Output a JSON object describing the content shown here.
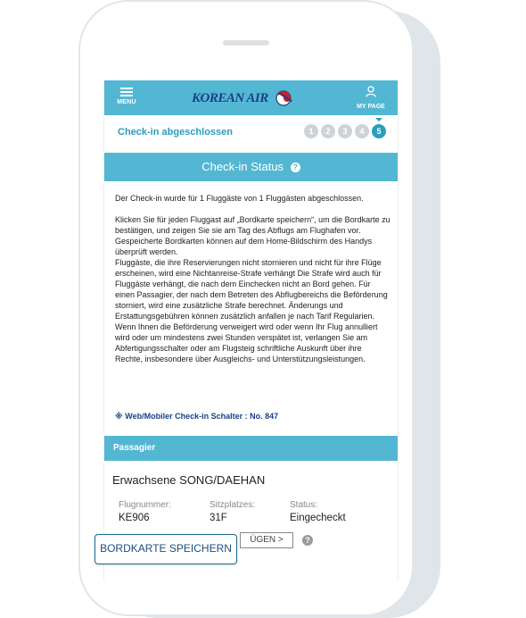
{
  "header": {
    "menu_label": "MENU",
    "brand": "KOREAN AIR",
    "mypage_label": "MY PAGE"
  },
  "steps": {
    "title": "Check-in abgeschlossen",
    "items": [
      "1",
      "2",
      "3",
      "4",
      "5"
    ],
    "active": "5"
  },
  "status": {
    "title": "Check-in Status",
    "help": "?",
    "paragraph_1": "Der Check-in wurde für 1 Fluggäste von 1 Fluggästen abgeschlossen.",
    "paragraph_2": "Klicken Sie für jeden Fluggast auf „Bordkarte speichern“, um die Bordkarte zu bestätigen, und zeigen Sie sie am Tag des Abflugs am Flughafen vor. Gespeicherte Bordkarten können auf dem Home-Bildschirm des Handys überprüft werden.",
    "paragraph_3": "Fluggäste, die ihre Reservierungen nicht stornieren und nicht für ihre Flüge erscheinen, wird eine Nichtanreise-Strafe verhängt Die Strafe wird auch für Fluggäste verhängt, die nach dem Einchecken nicht an Bord gehen. Für einen Passagier, der nach dem Betreten des Abflugbereichs die Beförderung storniert, wird eine zusätzliche Strafe berechnet. Änderungs und Erstattungsgebühren können zusätzlich anfallen je nach Tarif Regularien.",
    "paragraph_4": "Wenn Ihnen die Beförderung verweigert wird oder wenn Ihr Flug annulliert wird oder um mindestens zwei Stunden verspätet ist, verlangen Sie am Abfertigungsschalter oder am Flugsteig schriftliche Auskunft über ihre Rechte, insbesondere über Ausgleichs- und Unterstützungsleistungen.",
    "counter": "※ Web/Mobiler Check-in Schalter : No. 847"
  },
  "passenger": {
    "section_title": "Passagier",
    "name": "Erwachsene SONG/DAEHAN",
    "flight_label": "Flugnummer:",
    "flight_value": "KE906",
    "seat_label": "Sitzplatzes:",
    "seat_value": "31F",
    "status_label": "Status:",
    "status_value": "Eingecheckt",
    "partial_button": "ÜGEN >",
    "help": "?"
  },
  "save_button": "BORDKARTE SPEICHERN",
  "colors": {
    "accent": "#53b7d3",
    "accent_dark": "#2b9dbd",
    "brand_blue": "#1b3f87"
  }
}
